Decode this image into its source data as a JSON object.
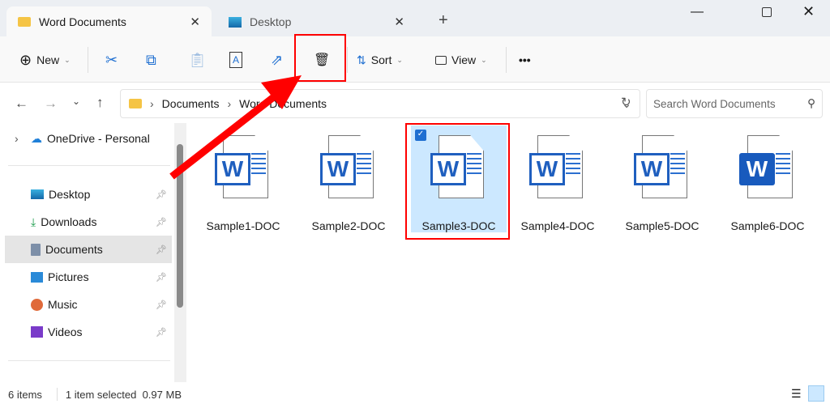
{
  "tabs": [
    {
      "label": "Word Documents",
      "icon": "folder-icon"
    },
    {
      "label": "Desktop",
      "icon": "desktop-icon"
    }
  ],
  "new_tab": "+",
  "toolbar": {
    "new_label": "New",
    "sort_label": "Sort",
    "view_label": "View",
    "more": "•••"
  },
  "address": {
    "path": [
      "Documents",
      "Word Documents"
    ]
  },
  "search": {
    "placeholder": "Search Word Documents"
  },
  "sidebar": {
    "onedrive": "OneDrive - Personal",
    "items": [
      {
        "label": "Desktop"
      },
      {
        "label": "Downloads"
      },
      {
        "label": "Documents",
        "selected": true
      },
      {
        "label": "Pictures"
      },
      {
        "label": "Music"
      },
      {
        "label": "Videos"
      }
    ]
  },
  "files": [
    {
      "name": "Sample1-DOC"
    },
    {
      "name": "Sample2-DOC"
    },
    {
      "name": "Sample3-DOC",
      "selected": true
    },
    {
      "name": "Sample4-DOC"
    },
    {
      "name": "Sample5-DOC"
    },
    {
      "name": "Sample6-DOC",
      "modern": true
    }
  ],
  "status": {
    "count": "6 items",
    "selected": "1 item selected",
    "size": "0.97 MB"
  },
  "colors": {
    "accent": "#1f6fd1",
    "highlight": "#ff0000",
    "selection": "#cce8ff"
  }
}
